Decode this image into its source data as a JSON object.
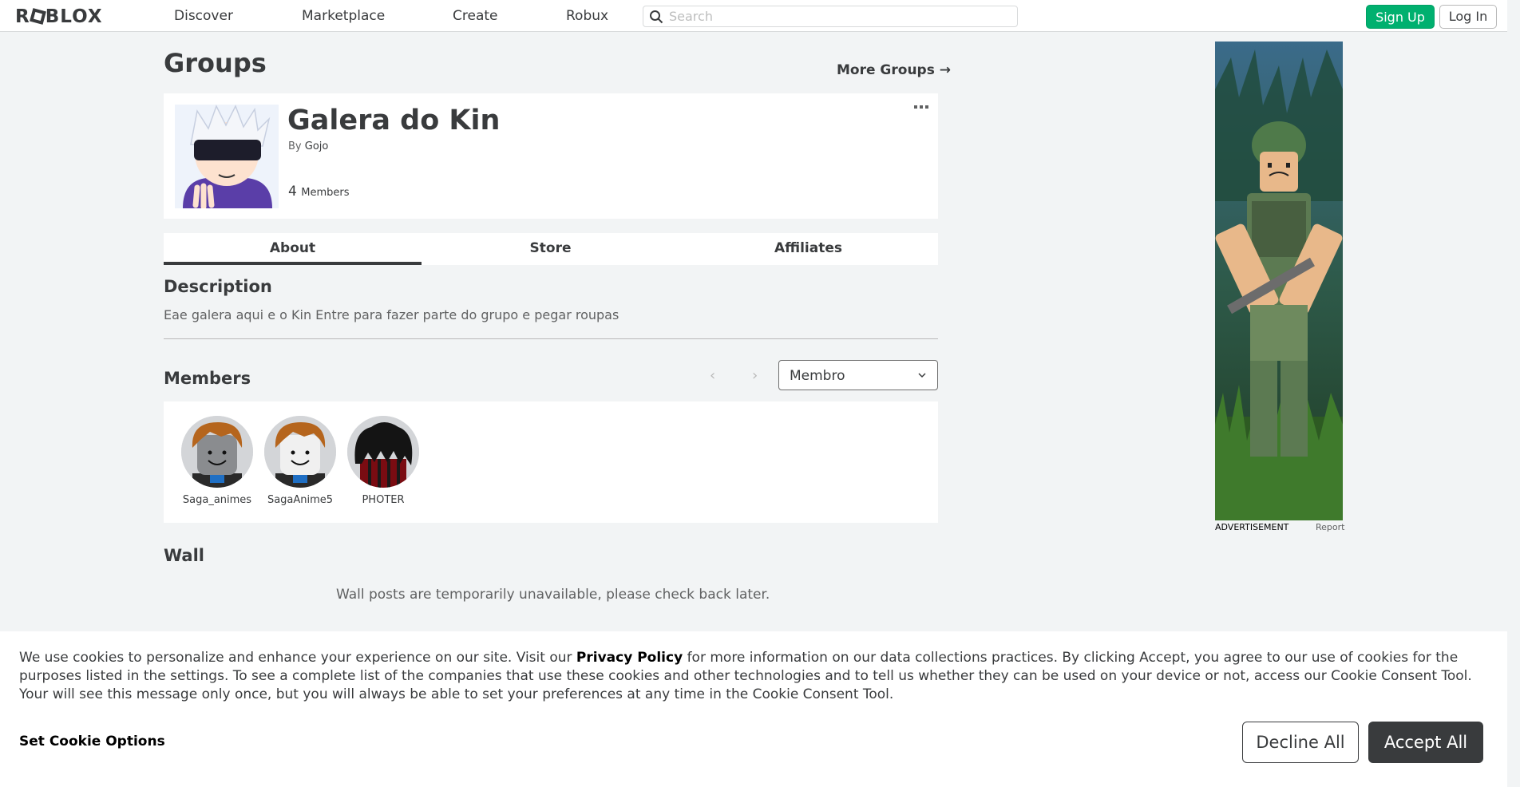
{
  "header": {
    "logo_text": "ROBLOX",
    "nav": [
      "Discover",
      "Marketplace",
      "Create",
      "Robux"
    ],
    "search_placeholder": "Search",
    "signup_label": "Sign Up",
    "login_label": "Log In"
  },
  "page": {
    "title": "Groups",
    "more_groups_label": "More Groups →"
  },
  "group": {
    "name": "Galera do Kin",
    "owner_prefix": "By",
    "owner": "Gojo",
    "member_count": "4",
    "member_label": "Members"
  },
  "tabs": [
    "About",
    "Store",
    "Affiliates"
  ],
  "active_tab": "About",
  "description": {
    "heading": "Description",
    "text": "Eae galera aqui e o Kin Entre para fazer parte do grupo e pegar roupas"
  },
  "members": {
    "heading": "Members",
    "role_filter": "Membro",
    "list": [
      {
        "name": "Saga_animes"
      },
      {
        "name": "SagaAnime5"
      },
      {
        "name": "PHOTER"
      }
    ]
  },
  "wall": {
    "heading": "Wall",
    "message": "Wall posts are temporarily unavailable, please check back later."
  },
  "ad": {
    "label": "ADVERTISEMENT",
    "report": "Report"
  },
  "cookie_banner": {
    "text_before": "We use cookies to personalize and enhance your experience on our site. Visit our ",
    "privacy_link": "Privacy Policy",
    "text_after": " for more information on our data collections practices. By clicking Accept, you agree to our use of cookies for the purposes listed in the settings. To see a complete list of the companies that use these cookies and other technologies and to tell us whether they can be used on your device or not, access our Cookie Consent Tool. Your will see this message only once, but you will always be able to set your preferences at any time in the Cookie Consent Tool.",
    "options_label": "Set Cookie Options",
    "decline_label": "Decline All",
    "accept_label": "Accept All"
  },
  "colors": {
    "signup_green": "#00b06f",
    "text_dark": "#393b3d",
    "page_bg": "#f2f4f5"
  }
}
